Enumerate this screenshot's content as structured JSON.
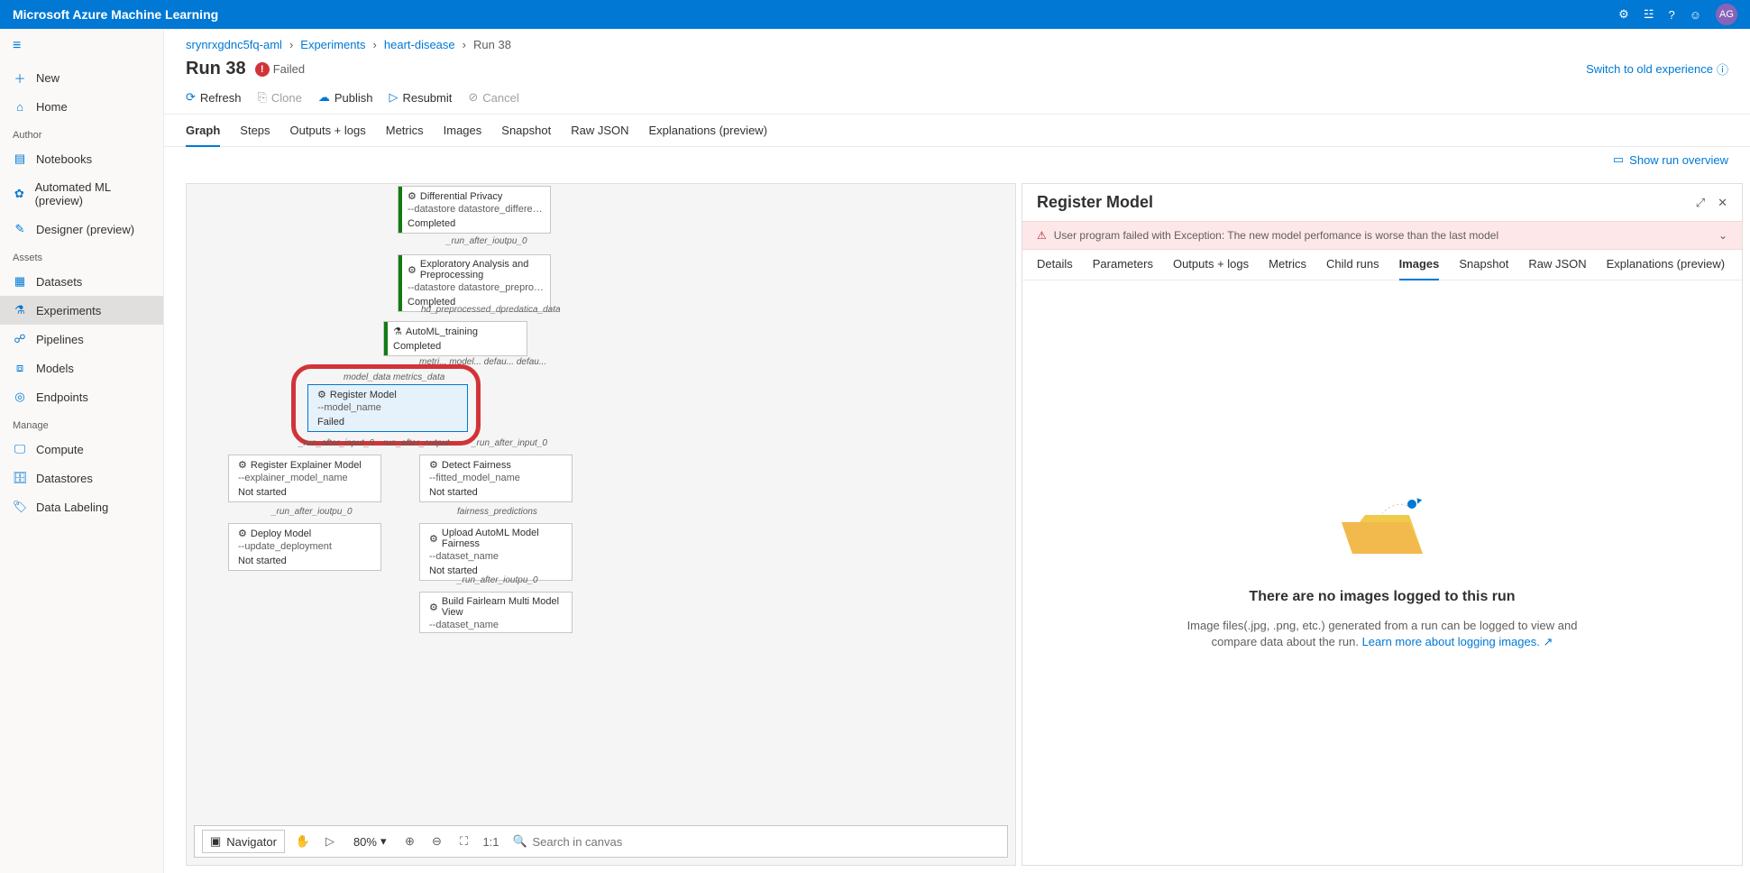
{
  "brand": "Microsoft Azure Machine Learning",
  "avatar_initials": "AG",
  "sidebar": {
    "new": "New",
    "home": "Home",
    "section_author": "Author",
    "notebooks": "Notebooks",
    "automl": "Automated ML (preview)",
    "designer": "Designer (preview)",
    "section_assets": "Assets",
    "datasets": "Datasets",
    "experiments": "Experiments",
    "pipelines": "Pipelines",
    "models": "Models",
    "endpoints": "Endpoints",
    "section_manage": "Manage",
    "compute": "Compute",
    "datastores": "Datastores",
    "datalabeling": "Data Labeling"
  },
  "breadcrumbs": {
    "workspace": "srynrxgdnc5fq-aml",
    "experiments": "Experiments",
    "exp_name": "heart-disease",
    "run": "Run 38"
  },
  "title": "Run 38",
  "status_text": "Failed",
  "switch_link": "Switch to old experience",
  "toolbar": {
    "refresh": "Refresh",
    "clone": "Clone",
    "publish": "Publish",
    "resubmit": "Resubmit",
    "cancel": "Cancel"
  },
  "tabs": {
    "graph": "Graph",
    "steps": "Steps",
    "outputs": "Outputs + logs",
    "metrics": "Metrics",
    "images": "Images",
    "snapshot": "Snapshot",
    "rawjson": "Raw JSON",
    "explanations": "Explanations (preview)"
  },
  "overview_link": "Show run overview",
  "graph": {
    "node_diff_privacy": {
      "title": "Differential Privacy",
      "subtitle": "--datastore datastore_differential_privacy_step",
      "status": "Completed"
    },
    "label_run_after_output0a": "_run_after_ioutpu_0",
    "node_eda": {
      "title": "Exploratory Analysis and Preprocessing",
      "subtitle": "--datastore datastore_preprocessing_step --",
      "status": "Completed"
    },
    "label_hd_preprocess": "hd_preprocessed_dpredatica_data",
    "node_automl": {
      "title": "AutoML_training",
      "status": "Completed"
    },
    "label_metri": "metri...  model...  defau...  defau...",
    "label_model_data": "model_data   metrics_data",
    "node_register": {
      "title": "Register Model",
      "subtitle": "--model_name",
      "status": "Failed"
    },
    "label_run_after_input0": "_run_after_input_0",
    "label_run_after_output": "run_after_output",
    "label_run_after_input0b": "_run_after_input_0",
    "node_explainer": {
      "title": "Register Explainer Model",
      "subtitle": "--explainer_model_name",
      "status": "Not started"
    },
    "node_fairness": {
      "title": "Detect Fairness",
      "subtitle": "--fitted_model_name",
      "status": "Not started"
    },
    "label_run_after_iooutpu0c": "_run_after_ioutpu_0",
    "label_fairness_predictions": "fairness_predictions",
    "node_deploy": {
      "title": "Deploy Model",
      "subtitle": "--update_deployment",
      "status": "Not started"
    },
    "node_upload_fair": {
      "title": "Upload AutoML Model Fairness",
      "subtitle": "--dataset_name",
      "status": "Not started"
    },
    "label_run_after_iooutpu0d": "_run_after_ioutpu_0",
    "node_build_fairlearn": {
      "title": "Build Fairlearn Multi Model View",
      "subtitle": "--dataset_name"
    }
  },
  "canvas_footer": {
    "navigator": "Navigator",
    "zoom": "80%",
    "search_placeholder": "Search in canvas"
  },
  "details": {
    "title": "Register Model",
    "error": "User program failed with Exception: The new model perfomance is worse than the last model",
    "tabs": {
      "details": "Details",
      "parameters": "Parameters",
      "outputs": "Outputs + logs",
      "metrics": "Metrics",
      "childruns": "Child runs",
      "images": "Images",
      "snapshot": "Snapshot",
      "rawjson": "Raw JSON",
      "explanations": "Explanations (preview)"
    },
    "empty_title": "There are no images logged to this run",
    "empty_desc": "Image files(.jpg, .png, etc.) generated from a run can be logged to view and compare data about the run.",
    "learn_more": "Learn more about logging images."
  }
}
